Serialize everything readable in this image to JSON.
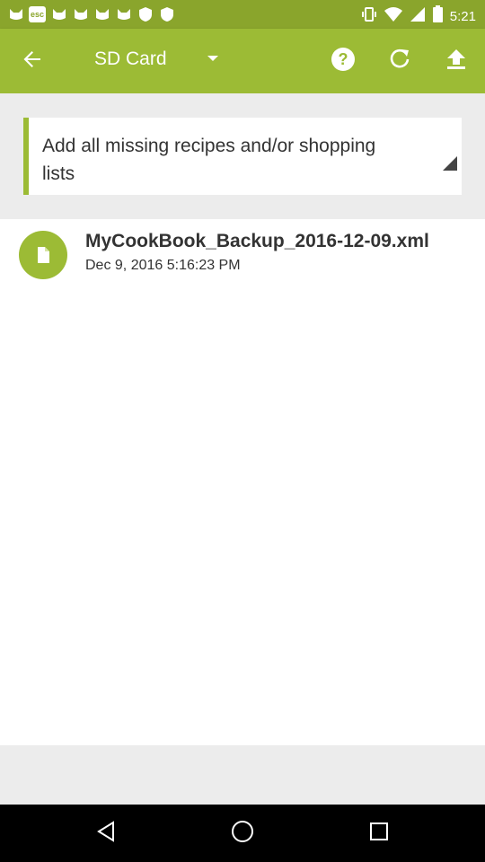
{
  "status_bar": {
    "time": "5:21",
    "left_icons": [
      "cat-icon",
      "esc-icon",
      "cat-icon",
      "cat-icon",
      "cat-icon",
      "cat-icon",
      "shield-icon",
      "shield-icon"
    ],
    "right_icons": [
      "vibrate-icon",
      "wifi-icon",
      "signal-icon",
      "battery-icon"
    ]
  },
  "toolbar": {
    "title": "SD Card",
    "back_icon": "arrow-back-icon",
    "dropdown_icon": "dropdown-caret-icon",
    "actions": [
      "help-icon",
      "refresh-icon",
      "upload-icon"
    ]
  },
  "import_option": {
    "label": "Add all missing recipes and/or shopping lists"
  },
  "files": [
    {
      "name": "MyCookBook_Backup_2016-12-09.xml",
      "date": "Dec 9, 2016 5:16:23 PM",
      "icon": "file-icon"
    }
  ],
  "nav_bar": {
    "buttons": [
      "back-triangle-icon",
      "home-circle-icon",
      "recents-square-icon"
    ]
  },
  "colors": {
    "status_bar": "#8aa52c",
    "toolbar": "#9cbb35",
    "accent": "#9cbb35",
    "text": "#333333",
    "gray_bg": "#ececec"
  }
}
